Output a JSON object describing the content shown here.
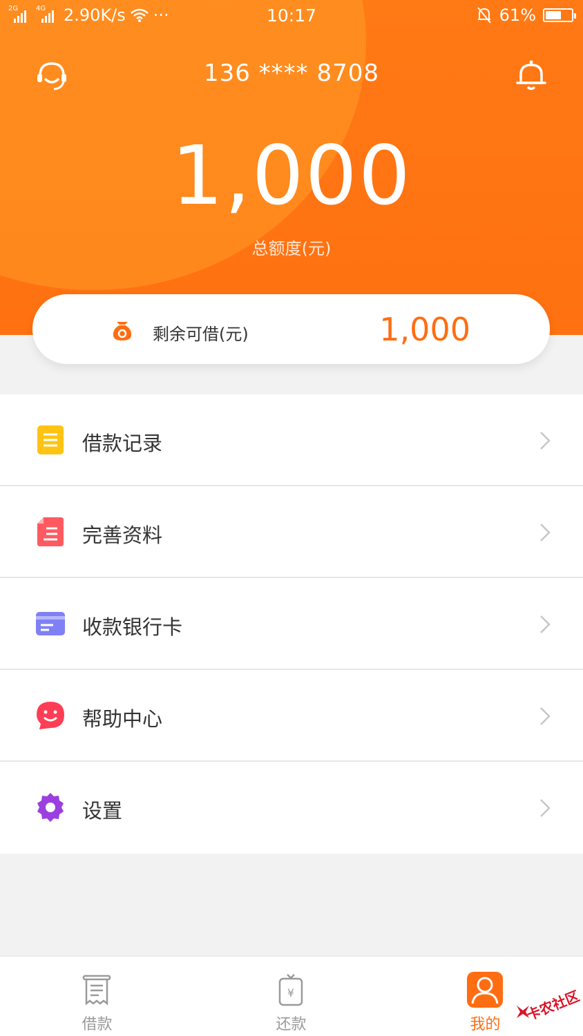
{
  "status_bar": {
    "signal1_label": "2G",
    "signal2_label": "4G",
    "net_speed": "2.90K/s",
    "more": "···",
    "time": "10:17",
    "battery_percent": "61%",
    "battery_level": 0.61
  },
  "header": {
    "phone": "136 **** 8708",
    "total_amount": "1,000",
    "total_label": "总额度(元)",
    "customer_service_icon": "headset-icon",
    "notification_icon": "bell-icon"
  },
  "remaining": {
    "icon": "money-bag-icon",
    "label": "剩余可借(元)",
    "value": "1,000"
  },
  "menu": {
    "items": [
      {
        "label": "借款记录",
        "icon": "document-list-icon",
        "color": "#ffc313"
      },
      {
        "label": "完善资料",
        "icon": "profile-form-icon",
        "color": "#ff5a61"
      },
      {
        "label": "收款银行卡",
        "icon": "bank-card-icon",
        "color": "#8080f5"
      },
      {
        "label": "帮助中心",
        "icon": "smiley-chat-icon",
        "color": "#ff3d55"
      },
      {
        "label": "设置",
        "icon": "gear-icon",
        "color": "#9b3fe0"
      }
    ]
  },
  "tabbar": {
    "tabs": [
      {
        "label": "借款",
        "icon": "receipt-icon",
        "active": false
      },
      {
        "label": "还款",
        "icon": "repay-yuan-icon",
        "active": false
      },
      {
        "label": "我的",
        "icon": "user-icon",
        "active": true
      }
    ]
  },
  "watermark": {
    "text": "卡农社区"
  },
  "colors": {
    "brand_orange": "#ff7312",
    "accent_text": "#ff6d12",
    "background": "#f2f2f2"
  }
}
